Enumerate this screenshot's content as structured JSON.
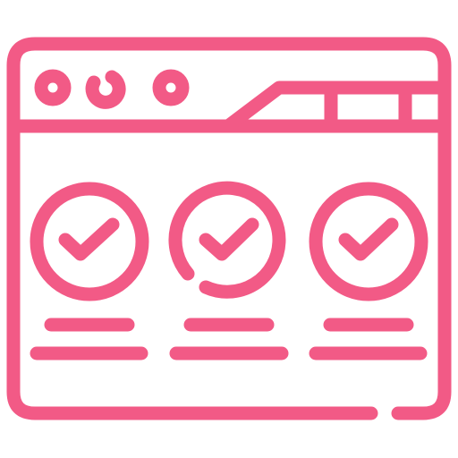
{
  "icon": {
    "name": "browser-window-checklist-icon",
    "stroke_color": "#f25a86",
    "background_color": "#ffffff"
  },
  "window_controls": [
    "dot-icon",
    "dot-icon",
    "dot-icon"
  ],
  "tabs": [
    "active-tab",
    "tab",
    "tab"
  ],
  "checklist": [
    {
      "name": "check-item-1",
      "icon": "check-circle-icon",
      "checked": true
    },
    {
      "name": "check-item-2",
      "icon": "check-circle-icon",
      "checked": true
    },
    {
      "name": "check-item-3",
      "icon": "check-circle-icon",
      "checked": true
    }
  ]
}
